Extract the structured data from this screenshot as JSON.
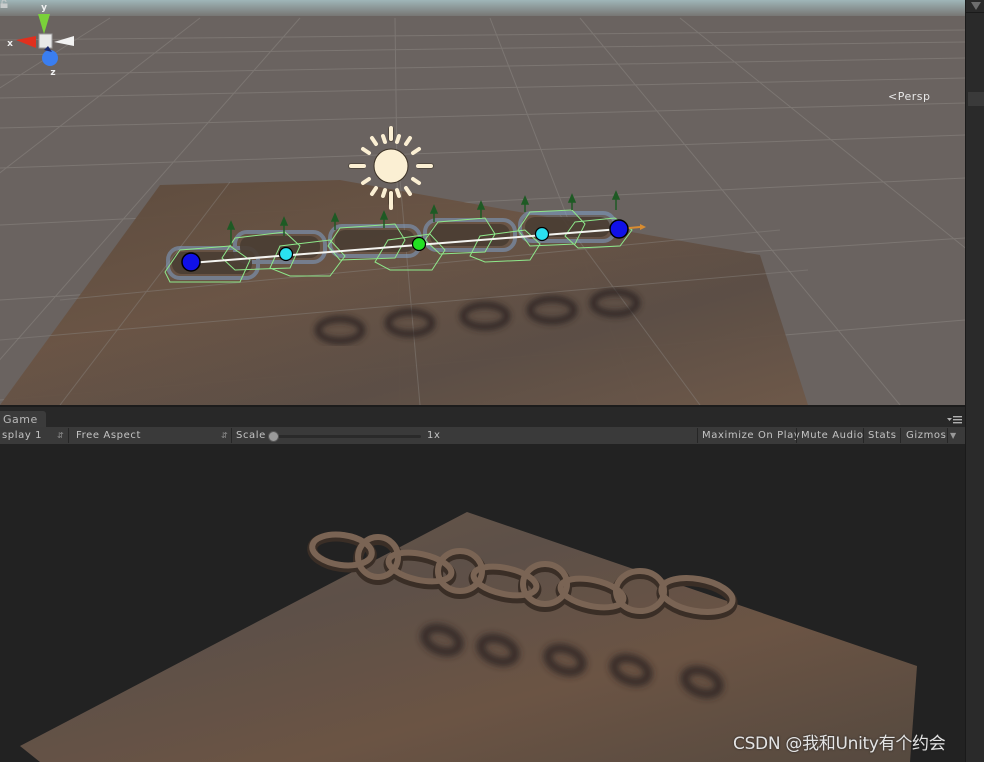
{
  "scene_view": {
    "projection_label": "Persp",
    "axis_gizmo": {
      "x_label": "x",
      "y_label": "y",
      "z_label": "z",
      "x_color": "#e0301e",
      "y_color": "#7ad13a",
      "z_color": "#3a7ef0"
    },
    "handles": [
      {
        "name": "chain-end-start",
        "color": "#1010e8"
      },
      {
        "name": "chain-joint-1",
        "color": "#2ae0f0"
      },
      {
        "name": "chain-joint-mid",
        "color": "#22e022"
      },
      {
        "name": "chain-joint-2",
        "color": "#2ae0f0"
      },
      {
        "name": "chain-end-finish",
        "color": "#1010e8"
      }
    ],
    "light_icon": "sun-icon"
  },
  "game_panel": {
    "tab_label": "Game",
    "toolbar": {
      "display_select": "splay 1",
      "aspect_select": "Free Aspect",
      "scale_label": "Scale",
      "scale_value": "1x",
      "scale_fraction": 0.0,
      "maximize_on_play": "Maximize On Play",
      "mute_audio": "Mute Audio",
      "stats": "Stats",
      "gizmos": "Gizmos"
    }
  },
  "watermark": "CSDN @我和Unity有个约会"
}
